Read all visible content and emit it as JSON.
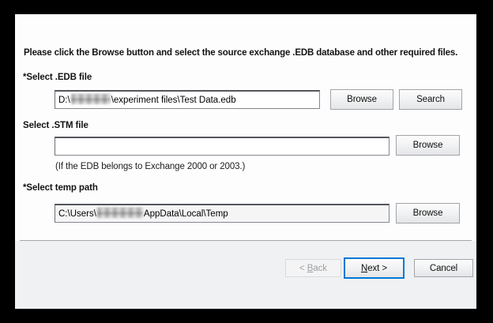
{
  "dialog": {
    "instruction": "Please click the Browse button and select the source exchange .EDB database and other required files.",
    "fields": {
      "edb": {
        "label": "*Select .EDB file",
        "value_prefix": "D:\\",
        "value_censored_segment": "hidden",
        "value_suffix": "\\experiment files\\Test Data.edb",
        "browse_label": "Browse",
        "search_label": "Search"
      },
      "stm": {
        "label": "Select .STM file",
        "value": "",
        "hint": "(If the EDB belongs to Exchange 2000 or 2003.)",
        "browse_label": "Browse"
      },
      "temp": {
        "label": "*Select temp path",
        "value_prefix": "C:\\Users\\",
        "value_censored_segment": "hidden",
        "value_suffix": "AppData\\Local\\Temp",
        "browse_label": "Browse"
      }
    },
    "footer": {
      "back": {
        "prefix": "< ",
        "mnemonic": "B",
        "rest": "ack"
      },
      "next": {
        "mnemonic": "N",
        "rest": "ext >"
      },
      "cancel_label": "Cancel"
    },
    "colors": {
      "frame": "#000000",
      "focus_accent": "#0078d7",
      "footer_bg": "#f0f1f3",
      "content_bg": "#fdfdfe"
    }
  }
}
